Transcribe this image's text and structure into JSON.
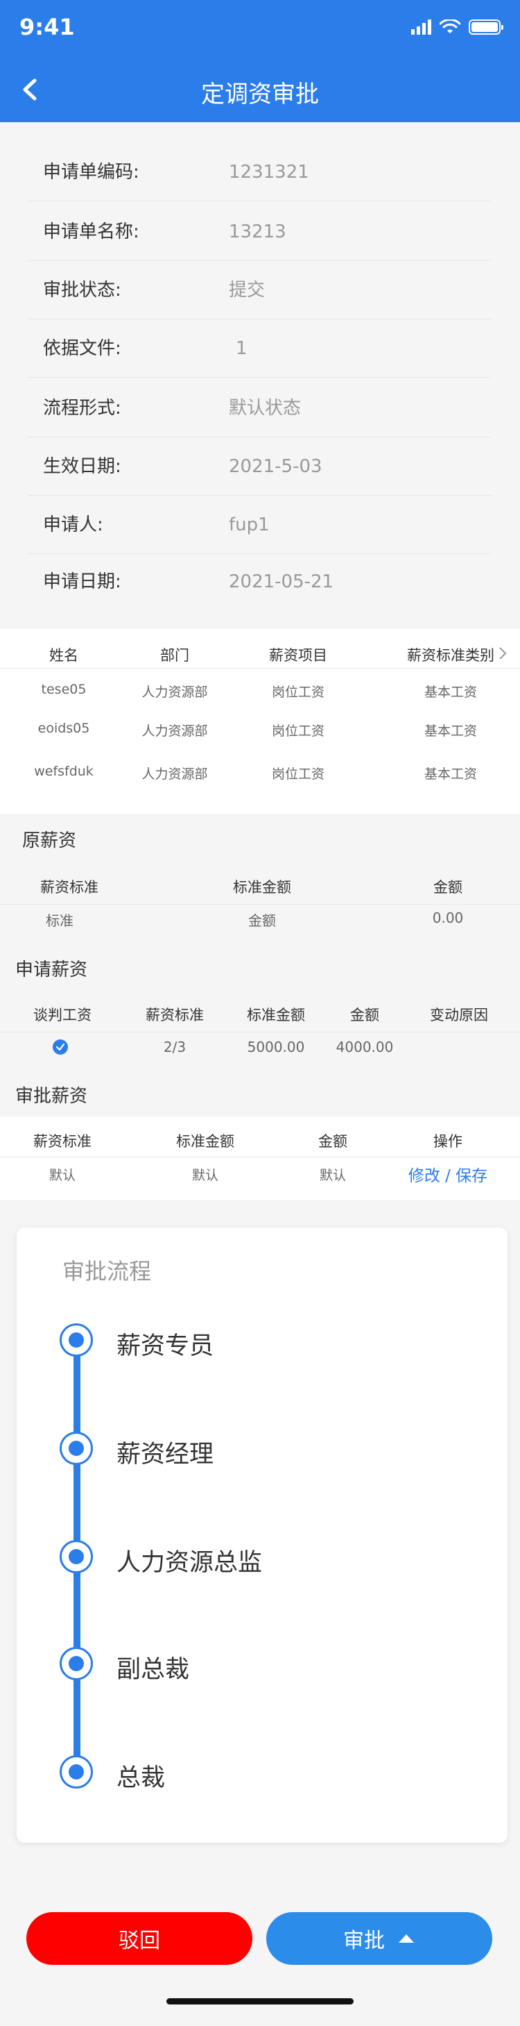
{
  "status_bar": {
    "time": "9:41"
  },
  "header": {
    "title": "定调资审批"
  },
  "info": [
    {
      "label": "申请单编码:",
      "value": "1231321"
    },
    {
      "label": "申请单名称:",
      "value": "13213"
    },
    {
      "label": "审批状态:",
      "value": "提交"
    },
    {
      "label": "依据文件:",
      "value": "1"
    },
    {
      "label": "流程形式:",
      "value": "默认状态"
    },
    {
      "label": "生效日期:",
      "value": "2021-5-03"
    },
    {
      "label": "申请人:",
      "value": "fup1"
    },
    {
      "label": "申请日期:",
      "value": "2021-05-21"
    }
  ],
  "employee_table": {
    "headers": [
      "姓名",
      "部门",
      "薪资项目",
      "薪资标准类别"
    ],
    "rows": [
      [
        "tese05",
        "人力资源部",
        "岗位工资",
        "基本工资"
      ],
      [
        "eoids05",
        "人力资源部",
        "岗位工资",
        "基本工资"
      ],
      [
        "wefsfduk",
        "人力资源部",
        "岗位工资",
        "基本工资"
      ]
    ]
  },
  "original_salary": {
    "title": "原薪资",
    "headers": [
      "薪资标准",
      "标准金额",
      "金额"
    ],
    "row": [
      "标准",
      "金额",
      "0.00"
    ]
  },
  "applied_salary": {
    "title": "申请薪资",
    "headers": [
      "谈判工资",
      "薪资标准",
      "标准金额",
      "金额",
      "变动原因"
    ],
    "row": [
      "",
      "2/3",
      "5000.00",
      "4000.00",
      ""
    ]
  },
  "approved_salary": {
    "title": "审批薪资",
    "headers": [
      "薪资标准",
      "标准金额",
      "金额",
      "操作"
    ],
    "row": [
      "默认",
      "默认",
      "默认"
    ],
    "action": "修改 / 保存"
  },
  "flow": {
    "title": "审批流程",
    "steps": [
      "薪资专员",
      "薪资经理",
      "人力资源总监",
      "副总裁",
      "总裁"
    ]
  },
  "buttons": {
    "reject": "驳回",
    "approve": "审批"
  },
  "colors": {
    "primary": "#2B7DE9",
    "danger": "#FF0000"
  }
}
